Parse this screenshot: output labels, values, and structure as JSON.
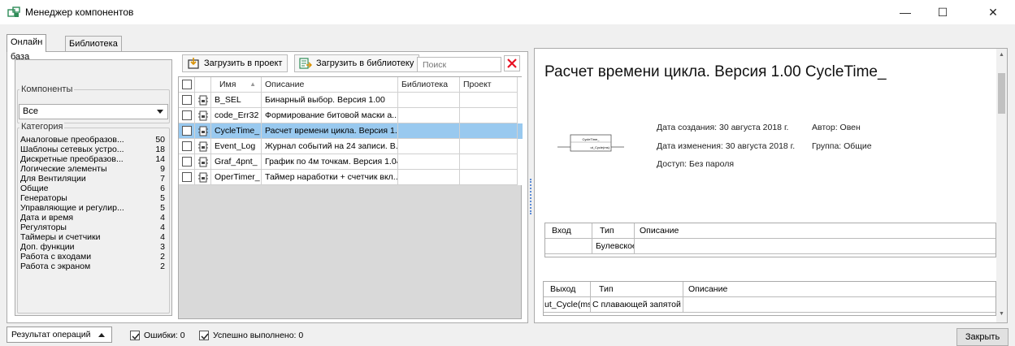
{
  "window": {
    "title": "Менеджер компонентов",
    "minimize": "—",
    "maximize": "☐",
    "close": "✕"
  },
  "tabs": [
    {
      "label": "Онлайн база",
      "active": true
    },
    {
      "label": "Библиотека",
      "active": false
    }
  ],
  "filters": {
    "components_label": "Компоненты",
    "components_value": "Все",
    "category_label": "Категория",
    "categories": [
      {
        "name": "Аналоговые преобразов...",
        "count": "50"
      },
      {
        "name": "Шаблоны сетевых устро...",
        "count": "18"
      },
      {
        "name": "Дискретные преобразов...",
        "count": "14"
      },
      {
        "name": "Логические элементы",
        "count": "9"
      },
      {
        "name": "Для Вентиляции",
        "count": "7"
      },
      {
        "name": "Общие",
        "count": "6"
      },
      {
        "name": "Генераторы",
        "count": "5"
      },
      {
        "name": "Управляющие и регулир...",
        "count": "5"
      },
      {
        "name": "Дата и время",
        "count": "4"
      },
      {
        "name": "Регуляторы",
        "count": "4"
      },
      {
        "name": "Таймеры и счетчики",
        "count": "4"
      },
      {
        "name": "Доп. функции",
        "count": "3"
      },
      {
        "name": "Работа с входами",
        "count": "2"
      },
      {
        "name": "Работа с экраном",
        "count": "2"
      }
    ]
  },
  "toolbar": {
    "load_project": "Загрузить в проект",
    "load_library": "Загрузить в библиотеку",
    "search_placeholder": "Поиск"
  },
  "grid": {
    "columns": [
      "Имя",
      "Описание",
      "Библиотека",
      "Проект"
    ],
    "rows": [
      {
        "name": "B_SEL",
        "desc": "Бинарный выбор. Версия 1.00",
        "selected": false
      },
      {
        "name": "code_Err32",
        "desc": "Формирование битовой маски а...",
        "selected": false
      },
      {
        "name": "CycleTime_",
        "desc": "Расчет времени цикла. Версия 1....",
        "selected": true
      },
      {
        "name": "Event_Log",
        "desc": "Журнал событий на 24 записи. В...",
        "selected": false
      },
      {
        "name": "Graf_4pnt_",
        "desc": "График по 4м точкам. Версия 1.04",
        "selected": false
      },
      {
        "name": "OperTimer_",
        "desc": "Таймер наработки + счетчик вкл...",
        "selected": false
      }
    ]
  },
  "detail": {
    "title": "Расчет времени цикла. Версия 1.00 CycleTime_",
    "created": "Дата создания: 30 августа 2018 г.",
    "modified": "Дата изменения: 30 августа 2018 г.",
    "access": "Доступ: Без пароля",
    "author": "Автор: Овен",
    "group": "Группа: Общие",
    "block_title": "CycleTime_",
    "block_output": "ut_Cycle(ms)",
    "inputs": {
      "headers": [
        "Вход",
        "Тип",
        "Описание"
      ],
      "rows": [
        {
          "name": "",
          "type": "Булевское",
          "desc": ""
        }
      ]
    },
    "outputs": {
      "headers": [
        "Выход",
        "Тип",
        "Описание"
      ],
      "rows": [
        {
          "name": "ut_Cycle(ms)",
          "type": "С плавающей запятой",
          "desc": ""
        }
      ]
    }
  },
  "status": {
    "op_result": "Результат операций",
    "errors": "Ошибки: 0",
    "success": "Успешно выполнено: 0",
    "close": "Закрыть"
  },
  "colors": {
    "selection": "#99c9ef",
    "clear_icon": "#e81123",
    "accent": "#0078d7"
  }
}
